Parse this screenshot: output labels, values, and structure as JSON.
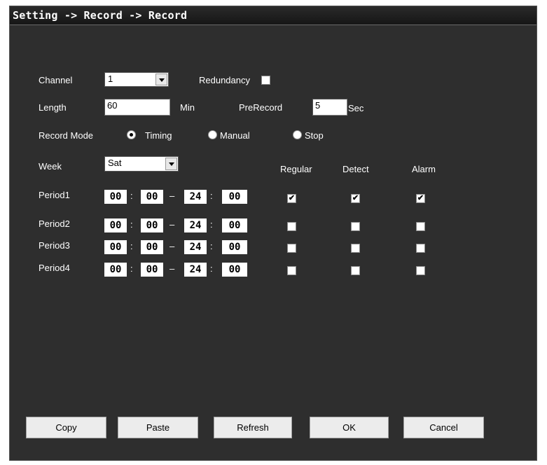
{
  "window": {
    "title": "Setting -> Record -> Record"
  },
  "channel": {
    "label": "Channel",
    "value": "1"
  },
  "redundancy": {
    "label": "Redundancy",
    "checked": false
  },
  "length": {
    "label": "Length",
    "value": "60",
    "unit": "Min"
  },
  "prerecord": {
    "label": "PreRecord",
    "value": "5",
    "unit": "Sec"
  },
  "record_mode": {
    "label": "Record Mode",
    "options": [
      "Timing",
      "Manual",
      "Stop"
    ],
    "selected": "Timing"
  },
  "week": {
    "label": "Week",
    "value": "Sat"
  },
  "columns": {
    "regular": "Regular",
    "detect": "Detect",
    "alarm": "Alarm"
  },
  "periods": [
    {
      "label": "Period1",
      "start_h": "00",
      "start_m": "00",
      "end_h": "24",
      "end_m": "00",
      "regular": true,
      "detect": true,
      "alarm": true
    },
    {
      "label": "Period2",
      "start_h": "00",
      "start_m": "00",
      "end_h": "24",
      "end_m": "00",
      "regular": false,
      "detect": false,
      "alarm": false
    },
    {
      "label": "Period3",
      "start_h": "00",
      "start_m": "00",
      "end_h": "24",
      "end_m": "00",
      "regular": false,
      "detect": false,
      "alarm": false
    },
    {
      "label": "Period4",
      "start_h": "00",
      "start_m": "00",
      "end_h": "24",
      "end_m": "00",
      "regular": false,
      "detect": false,
      "alarm": false
    }
  ],
  "buttons": {
    "copy": "Copy",
    "paste": "Paste",
    "refresh": "Refresh",
    "ok": "OK",
    "cancel": "Cancel"
  },
  "symbols": {
    "colon": ":",
    "dash": "–",
    "check": "✔"
  }
}
